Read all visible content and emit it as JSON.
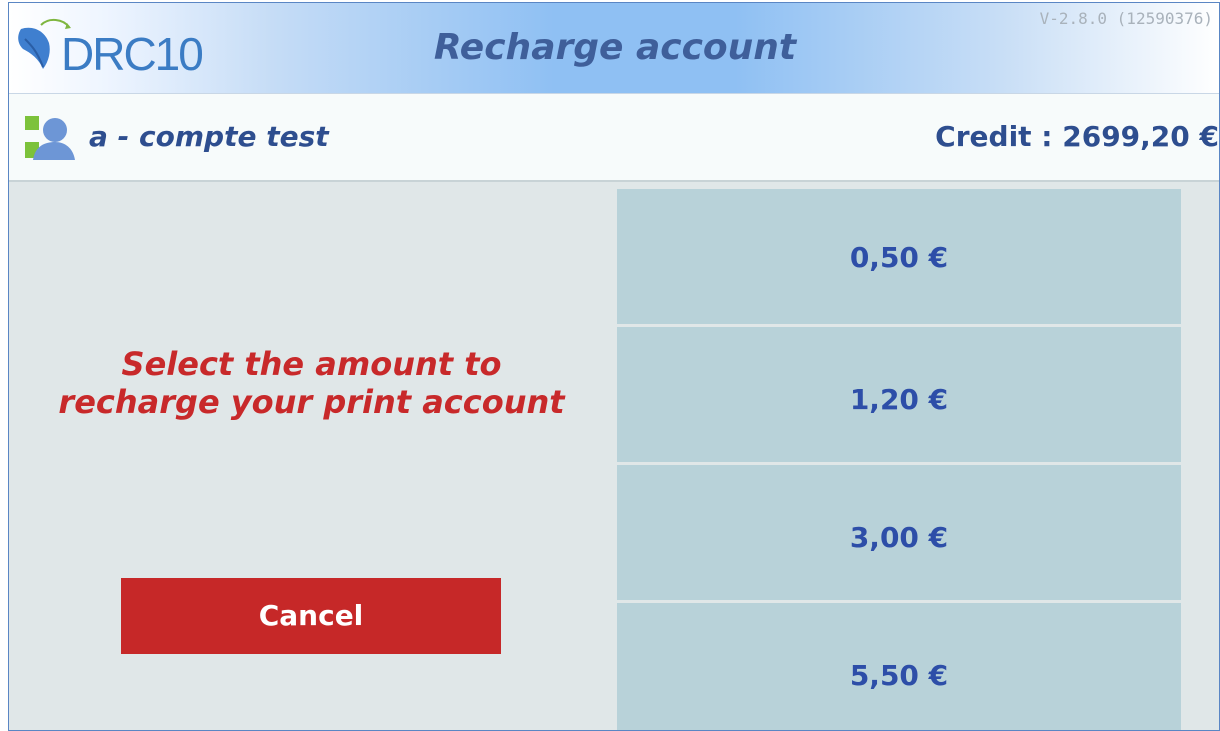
{
  "header": {
    "logo_text": "DRC10",
    "title": "Recharge account",
    "version": "V-2.8.0 (12590376)"
  },
  "user": {
    "icon": "user-icon",
    "name": "a - compte test",
    "credit": "Credit : 2699,20 €"
  },
  "main": {
    "instruction_line1": "Select the amount to",
    "instruction_line2": "recharge your print account",
    "cancel_label": "Cancel"
  },
  "amounts": [
    "0,50 €",
    "1,20 €",
    "3,00 €",
    "5,50 €"
  ],
  "colors": {
    "accent_blue": "#2e4e8f",
    "alert_red": "#c62828",
    "amount_button_bg": "#b8d2d9",
    "page_bg": "#e0e7e8"
  }
}
